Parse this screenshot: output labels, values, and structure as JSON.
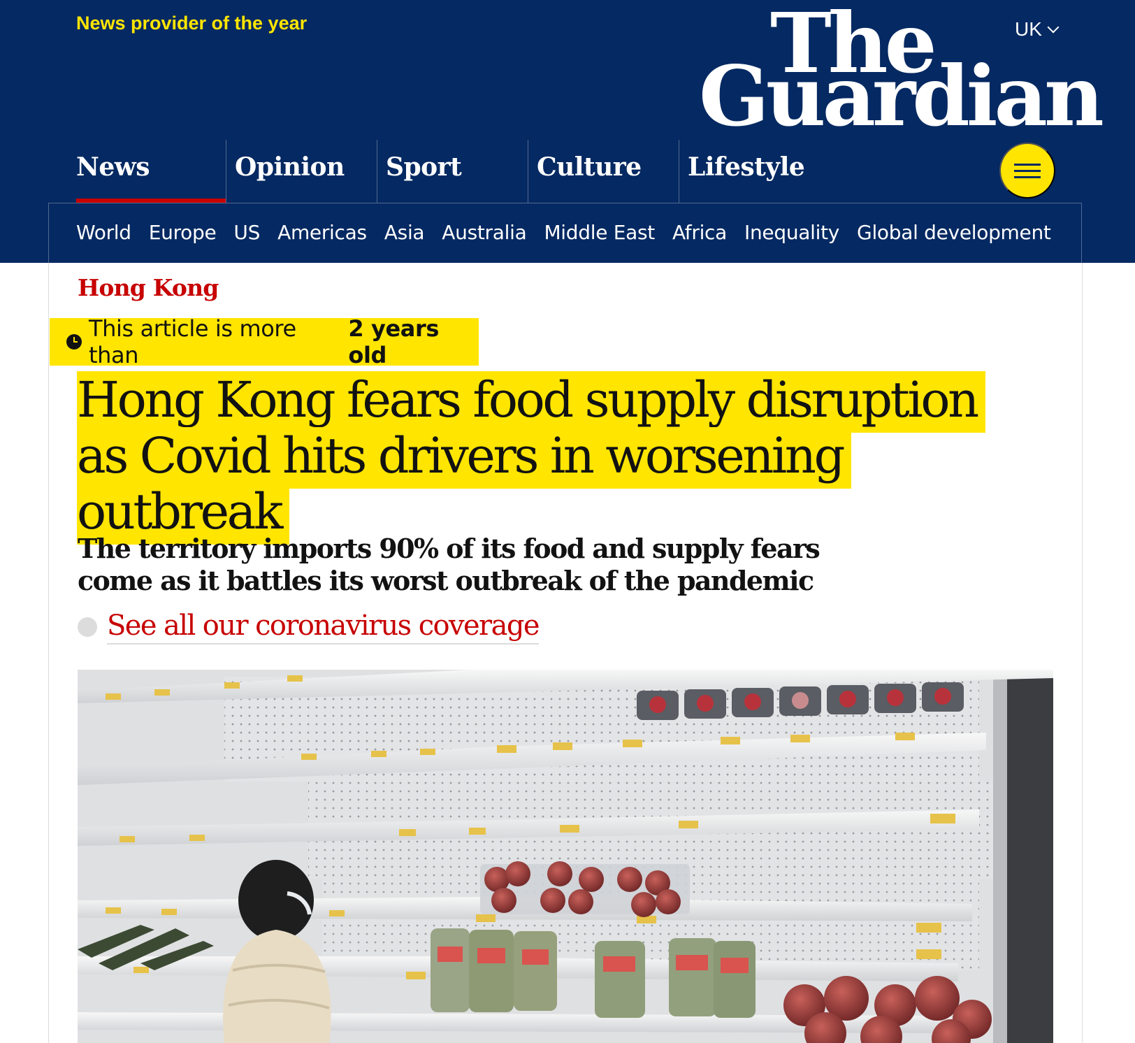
{
  "masthead": {
    "tagline": "News provider of the year",
    "edition": "UK",
    "logo_line1": "The",
    "logo_line2": "Guardian",
    "colors": {
      "background": "#052962",
      "accent": "#ffe500",
      "news_underline": "#c70000"
    }
  },
  "pillars": [
    {
      "label": "News",
      "active": true
    },
    {
      "label": "Opinion",
      "active": false
    },
    {
      "label": "Sport",
      "active": false
    },
    {
      "label": "Culture",
      "active": false
    },
    {
      "label": "Lifestyle",
      "active": false
    }
  ],
  "menu": {
    "icon": "hamburger-icon"
  },
  "subnav": [
    "World",
    "Europe",
    "US",
    "Americas",
    "Asia",
    "Australia",
    "Middle East",
    "Africa",
    "Inequality",
    "Global development"
  ],
  "article": {
    "kicker": "Hong Kong",
    "age_warning": {
      "prefix": "This article is more than",
      "age": "2 years old",
      "icon": "clock-icon"
    },
    "headline": "Hong Kong fears food supply disruption as Covid hits drivers in worsening outbreak",
    "standfirst": "The territory imports 90% of its food and supply fears come as it battles its worst outbreak of the pandemic",
    "coverage_link": "See all our coronavirus coverage",
    "image": {
      "description_icon": "photo-supermarket-empty-shelves"
    }
  }
}
